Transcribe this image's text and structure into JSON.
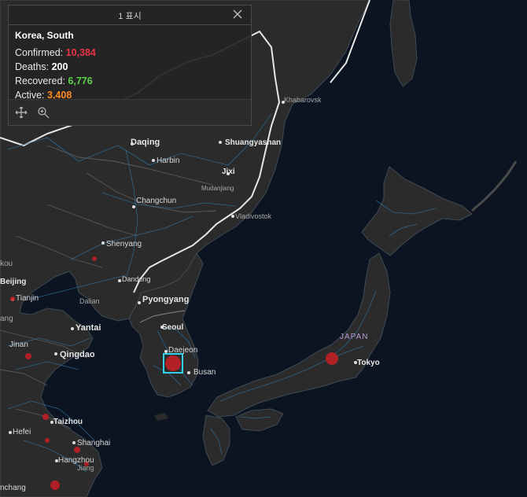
{
  "popup": {
    "feature_count": "1 표시",
    "title": "Korea, South",
    "stats": [
      {
        "label": "Confirmed:",
        "value": "10,384",
        "color": "#e8334a"
      },
      {
        "label": "Deaths:",
        "value": "200",
        "color": "#ffffff"
      },
      {
        "label": "Recovered:",
        "value": "6,776",
        "color": "#5ed14a"
      },
      {
        "label": "Active:",
        "value": "3,408",
        "color": "#ff8a1e"
      }
    ],
    "actions": [
      "move-icon",
      "zoom-to-icon"
    ],
    "close_icon": "close-icon"
  },
  "map": {
    "labels": {
      "khabarovsk": "Khabarovsk",
      "daqing": "Daqing",
      "shuangyashan": "Shuangyashan",
      "harbin": "Harbin",
      "jixi": "Jixi",
      "mudanjiang": "Mudanjiang",
      "changchun": "Changchun",
      "vladivostok": "Vladivostok",
      "shenyang": "Shenyang",
      "dandong": "Dandong",
      "pyongyang": "Pyongyang",
      "dalian": "Dalian",
      "yantai": "Yantai",
      "seoul": "Seoul",
      "daejeon": "Daejeon",
      "busan": "Busan",
      "jinan": "Jinan",
      "qingdao": "Qingdao",
      "japan": "JAPAN",
      "tokyo": "Tokyo",
      "taizhou": "Taizhou",
      "shanghai": "Shanghai",
      "hefei": "Hefei",
      "hangzhou": "Hangzhou",
      "tianjin": "Tianjin",
      "beijing": "Beijing",
      "kou": "kou",
      "ang": "ang",
      "nchang": "nchang",
      "jiang_edge": "Jiang"
    },
    "colors": {
      "land": "#2b2b2b",
      "water": "#0b1420",
      "roads": "#2f6f9a",
      "case_marker": "#c81e24",
      "selection": "#33d0e6"
    }
  }
}
